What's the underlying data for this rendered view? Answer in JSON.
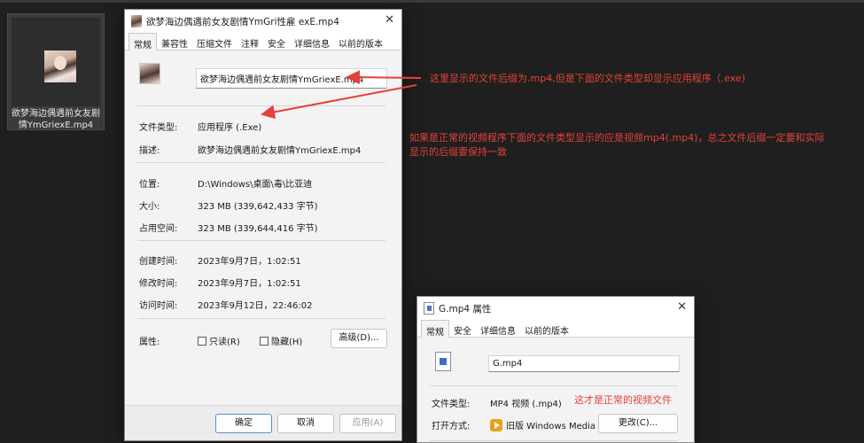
{
  "desktop_file": {
    "name": "欲梦海边偶遇前女友剧情YmGriexE.mp4"
  },
  "main_dialog": {
    "title": "欲梦海边偶遇前女友剧情YmGri性雇 exE.mp4",
    "tabs": [
      "常规",
      "兼容性",
      "压缩文件",
      "注释",
      "安全",
      "详细信息",
      "以前的版本"
    ],
    "filename": "欲梦海边偶遇前女友剧情YmGriexE.mp4",
    "fields": {
      "type_label": "文件类型:",
      "type_value": "应用程序 (.Exe)",
      "desc_label": "描述:",
      "desc_value": "欲梦海边偶遇前女友剧情YmGriexE.mp4",
      "location_label": "位置:",
      "location_value": "D:\\Windows\\桌面\\毒\\比亚迪",
      "size_label": "大小:",
      "size_value": "323 MB (339,642,433 字节)",
      "disk_label": "占用空间:",
      "disk_value": "323 MB (339,644,416 字节)",
      "created_label": "创建时间:",
      "created_value": "2023年9月7日，1:02:51",
      "modified_label": "修改时间:",
      "modified_value": "2023年9月7日，1:02:51",
      "accessed_label": "访问时间:",
      "accessed_value": "2023年9月12日，22:46:02",
      "attr_label": "属性:",
      "readonly_label": "只读(R)",
      "hidden_label": "隐藏(H)",
      "advanced_label": "高级(D)..."
    },
    "buttons": {
      "ok": "确定",
      "cancel": "取消",
      "apply": "应用(A)"
    }
  },
  "second_dialog": {
    "title": "G.mp4 属性",
    "tabs": [
      "常规",
      "安全",
      "详细信息",
      "以前的版本"
    ],
    "filename": "G.mp4",
    "type_label": "文件类型:",
    "type_value": "MP4 视频 (.mp4)",
    "open_label": "打开方式:",
    "open_value": "旧版 Windows Media Pl",
    "change_label": "更改(C)..."
  },
  "annotations": {
    "a1": "这里显示的文件后缀为.mp4,但是下面的文件类型却显示应用程序（.exe)",
    "a2_line1": "如果是正常的视频程序下面的文件类型显示的应是视频mp4(.mp4)，总之文件后缀一定要和实际",
    "a2_line2": "显示的后缀要保持一致",
    "a3": "这才是正常的视频文件"
  },
  "colors": {
    "annotation_red": "#e4413a",
    "dialog_bg": "#f3f3f3",
    "desktop_bg": "#1f1f1f"
  }
}
